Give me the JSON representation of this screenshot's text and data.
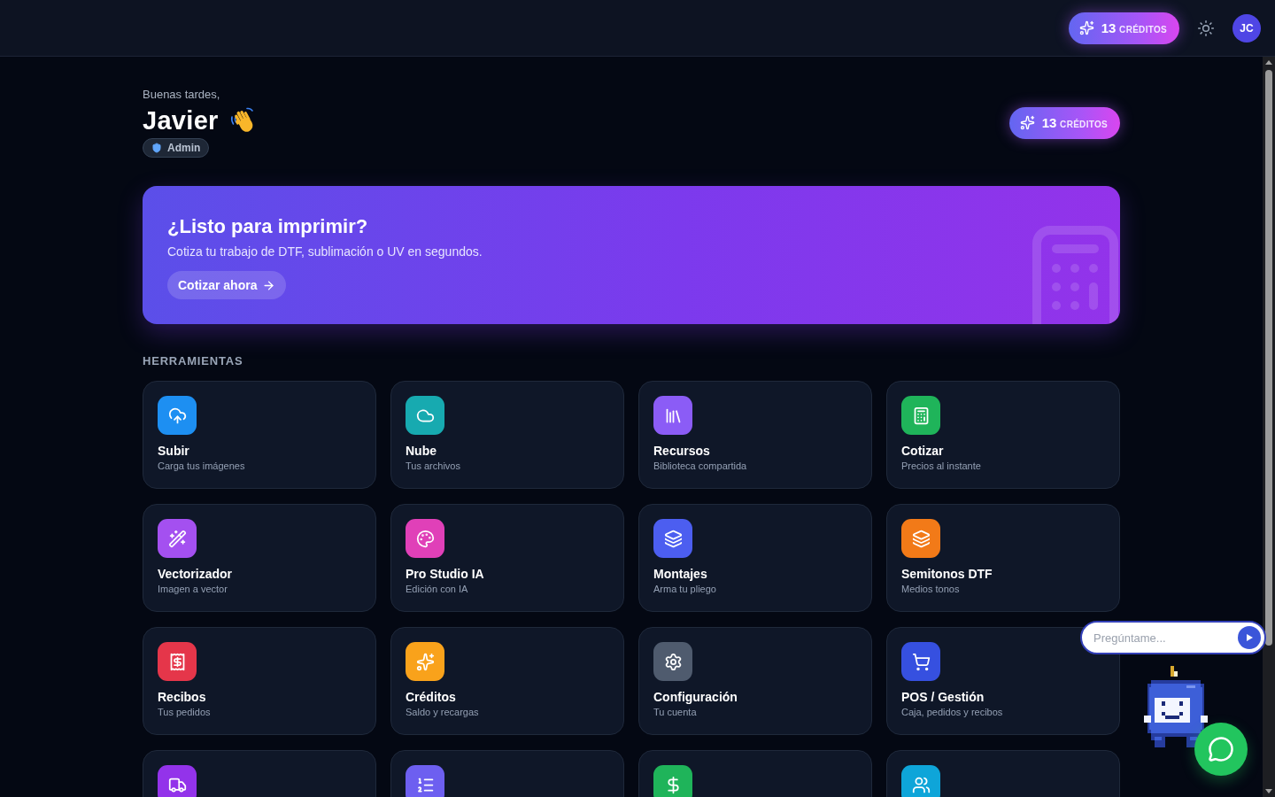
{
  "top_bar": {
    "credits": {
      "count": "13",
      "label": "CRÉDITOS"
    },
    "avatar": "JC"
  },
  "header": {
    "greeting": "Buenas tardes,",
    "name": "Javier",
    "role": "Admin",
    "credits": {
      "count": "13",
      "label": "CRÉDITOS"
    }
  },
  "banner": {
    "title": "¿Listo para imprimir?",
    "subtitle": "Cotiza tu trabajo de DTF, sublimación o UV en segundos.",
    "button": "Cotizar ahora"
  },
  "tools": {
    "heading": "HERRAMIENTAS",
    "items": [
      {
        "title": "Subir",
        "subtitle": "Carga tus imágenes",
        "color": "#1d8ff2"
      },
      {
        "title": "Nube",
        "subtitle": "Tus archivos",
        "color": "#17aab0"
      },
      {
        "title": "Recursos",
        "subtitle": "Biblioteca compartida",
        "color": "#8b5cf6"
      },
      {
        "title": "Cotizar",
        "subtitle": "Precios al instante",
        "color": "#1fb45a"
      },
      {
        "title": "Vectorizador",
        "subtitle": "Imagen a vector",
        "color": "#a450f0"
      },
      {
        "title": "Pro Studio IA",
        "subtitle": "Edición con IA",
        "color": "#e040b8"
      },
      {
        "title": "Montajes",
        "subtitle": "Arma tu pliego",
        "color": "#4c5ef0"
      },
      {
        "title": "Semitonos DTF",
        "subtitle": "Medios tonos",
        "color": "#f27a18"
      },
      {
        "title": "Recibos",
        "subtitle": "Tus pedidos",
        "color": "#e5364a"
      },
      {
        "title": "Créditos",
        "subtitle": "Saldo y recargas",
        "color": "#f9a21b"
      },
      {
        "title": "Configuración",
        "subtitle": "Tu cuenta",
        "color": "#4f5b6e"
      },
      {
        "title": "POS / Gestión",
        "subtitle": "Caja, pedidos y recibos",
        "color": "#3650e0"
      },
      {
        "color": "#9333ea"
      },
      {
        "color": "#6d5ff0"
      },
      {
        "color": "#1fb45a"
      },
      {
        "color": "#0ea5d9"
      }
    ]
  },
  "assistant": {
    "placeholder": "Pregúntame..."
  }
}
